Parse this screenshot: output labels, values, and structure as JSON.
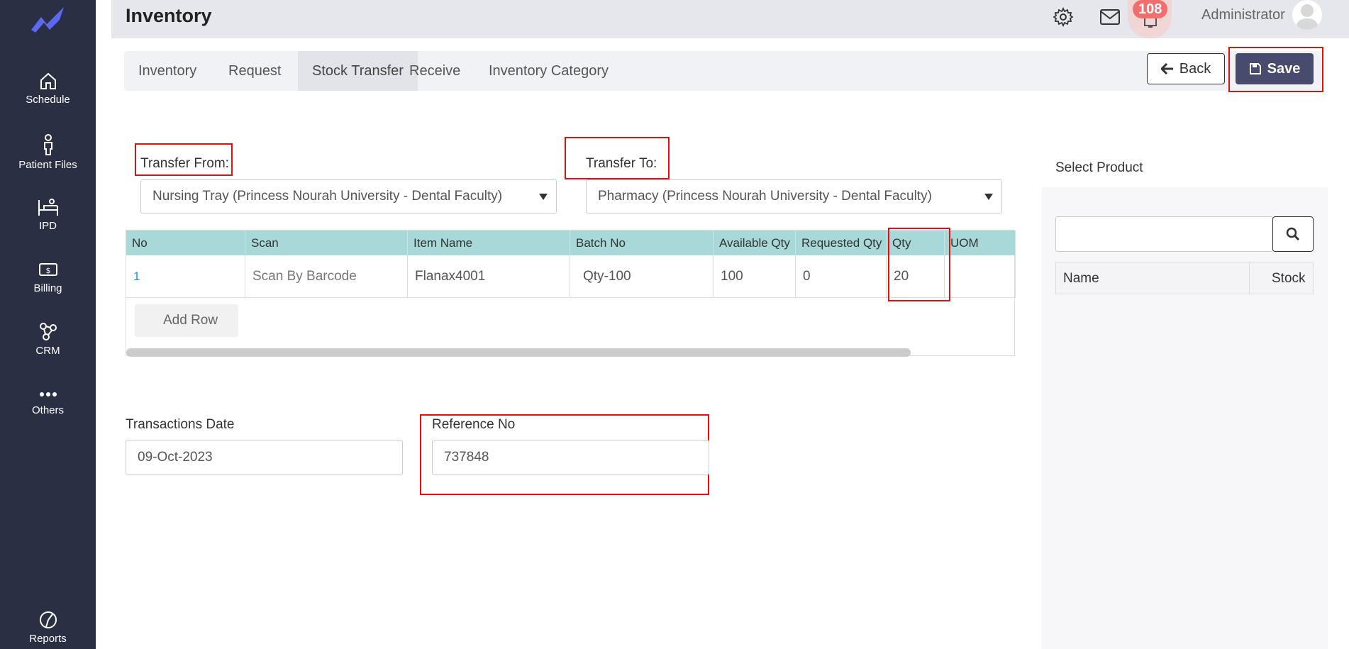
{
  "sidebar": {
    "items": [
      {
        "label": "Schedule",
        "icon": "home-icon"
      },
      {
        "label": "Patient Files",
        "icon": "person-icon"
      },
      {
        "label": "IPD",
        "icon": "bed-icon"
      },
      {
        "label": "Billing",
        "icon": "money-icon"
      },
      {
        "label": "CRM",
        "icon": "network-icon"
      },
      {
        "label": "Others",
        "icon": "more-icon"
      },
      {
        "label": "Reports",
        "icon": "pie-chart-icon"
      }
    ]
  },
  "header": {
    "title": "Inventory",
    "notification_count": "108",
    "user_name": "Administrator"
  },
  "tabs": [
    {
      "label": "Inventory"
    },
    {
      "label": "Request"
    },
    {
      "label": "Stock Transfer"
    },
    {
      "label": "Receive"
    },
    {
      "label": "Inventory Category"
    }
  ],
  "actions": {
    "back_label": "Back",
    "save_label": "Save"
  },
  "form": {
    "transfer_from_label": "Transfer From:",
    "transfer_from_value": "Nursing Tray (Princess Nourah University - Dental Faculty)",
    "transfer_to_label": "Transfer To:",
    "transfer_to_value": "Pharmacy (Princess Nourah University - Dental Faculty)",
    "transactions_date_label": "Transactions Date",
    "transactions_date_value": "09-Oct-2023",
    "reference_no_label": "Reference No",
    "reference_no_value": "737848"
  },
  "grid": {
    "columns": [
      "No",
      "Scan",
      "Item Name",
      "Batch No",
      "Available Qty",
      "Requested Qty",
      "Qty",
      "UOM"
    ],
    "rows": [
      {
        "no": "1",
        "scan": "Scan By Barcode",
        "item_name": "Flanax4001",
        "batch_no": "Qty-100",
        "available_qty": "100",
        "requested_qty": "0",
        "qty": "20",
        "uom": ""
      }
    ],
    "add_row_label": "Add Row"
  },
  "product_panel": {
    "label": "Select Product",
    "search_value": "",
    "columns": [
      "Name",
      "Stock"
    ]
  },
  "colors": {
    "sidebar_bg": "#2b2f44",
    "save_button": "#484a6e",
    "grid_header": "#a8d8d8",
    "highlight": "#e01010"
  }
}
